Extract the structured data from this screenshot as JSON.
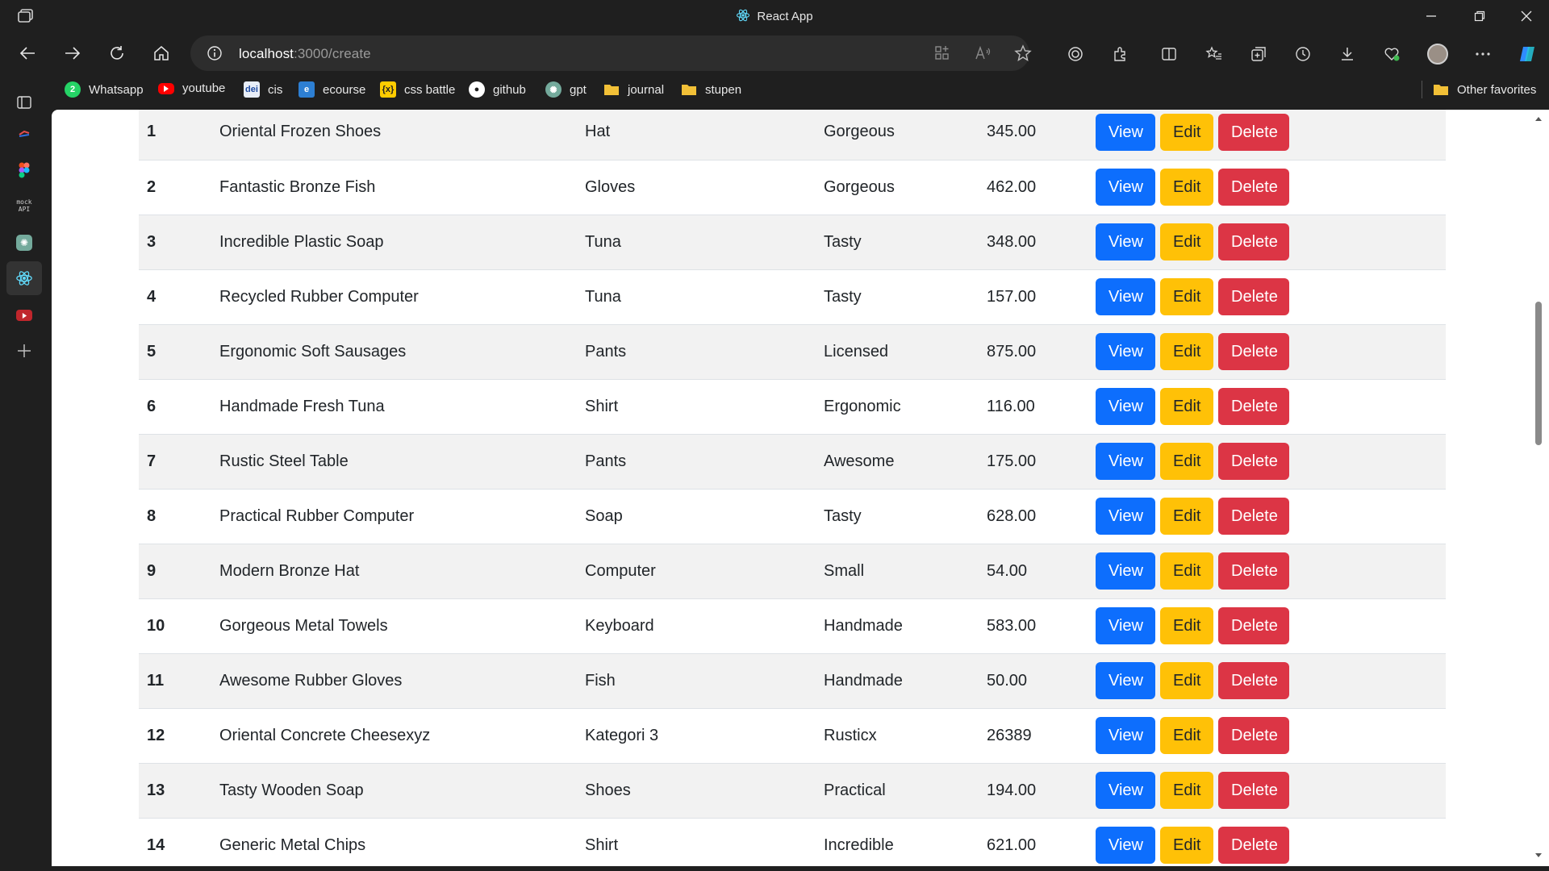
{
  "window": {
    "title": "React App"
  },
  "address": {
    "host": "localhost",
    "rest": ":3000/create"
  },
  "favorites": [
    {
      "label": "Whatsapp",
      "icon": "whatsapp-icon",
      "color": "#25d366"
    },
    {
      "label": "youtube",
      "icon": "youtube-icon",
      "color": "#ff0000"
    },
    {
      "label": "cis",
      "icon": "cis-icon",
      "color": "#1e4aa0"
    },
    {
      "label": "ecourse",
      "icon": "ecourse-icon",
      "color": "#2d7fd3"
    },
    {
      "label": "css battle",
      "icon": "css-battle-icon",
      "color": "#ffcc00"
    },
    {
      "label": "github",
      "icon": "github-icon",
      "color": "#ffffff"
    },
    {
      "label": "gpt",
      "icon": "gpt-icon",
      "color": "#74aa9c"
    },
    {
      "label": "journal",
      "icon": "folder-icon",
      "color": "#f2c037"
    },
    {
      "label": "stupen",
      "icon": "folder-icon",
      "color": "#f2c037"
    }
  ],
  "other_favorites": "Other favorites",
  "buttons": {
    "view": "View",
    "edit": "Edit",
    "delete": "Delete"
  },
  "rows": [
    {
      "id": "1",
      "name": "Oriental Frozen Shoes",
      "category": "Hat",
      "adjective": "Gorgeous",
      "price": "345.00"
    },
    {
      "id": "2",
      "name": "Fantastic Bronze Fish",
      "category": "Gloves",
      "adjective": "Gorgeous",
      "price": "462.00"
    },
    {
      "id": "3",
      "name": "Incredible Plastic Soap",
      "category": "Tuna",
      "adjective": "Tasty",
      "price": "348.00"
    },
    {
      "id": "4",
      "name": "Recycled Rubber Computer",
      "category": "Tuna",
      "adjective": "Tasty",
      "price": "157.00"
    },
    {
      "id": "5",
      "name": "Ergonomic Soft Sausages",
      "category": "Pants",
      "adjective": "Licensed",
      "price": "875.00"
    },
    {
      "id": "6",
      "name": "Handmade Fresh Tuna",
      "category": "Shirt",
      "adjective": "Ergonomic",
      "price": "116.00"
    },
    {
      "id": "7",
      "name": "Rustic Steel Table",
      "category": "Pants",
      "adjective": "Awesome",
      "price": "175.00"
    },
    {
      "id": "8",
      "name": "Practical Rubber Computer",
      "category": "Soap",
      "adjective": "Tasty",
      "price": "628.00"
    },
    {
      "id": "9",
      "name": "Modern Bronze Hat",
      "category": "Computer",
      "adjective": "Small",
      "price": "54.00"
    },
    {
      "id": "10",
      "name": "Gorgeous Metal Towels",
      "category": "Keyboard",
      "adjective": "Handmade",
      "price": "583.00"
    },
    {
      "id": "11",
      "name": "Awesome Rubber Gloves",
      "category": "Fish",
      "adjective": "Handmade",
      "price": "50.00"
    },
    {
      "id": "12",
      "name": "Oriental Concrete Cheesexyz",
      "category": "Kategori 3",
      "adjective": "Rusticx",
      "price": "26389"
    },
    {
      "id": "13",
      "name": "Tasty Wooden Soap",
      "category": "Shoes",
      "adjective": "Practical",
      "price": "194.00"
    },
    {
      "id": "14",
      "name": "Generic Metal Chips",
      "category": "Shirt",
      "adjective": "Incredible",
      "price": "621.00"
    }
  ]
}
